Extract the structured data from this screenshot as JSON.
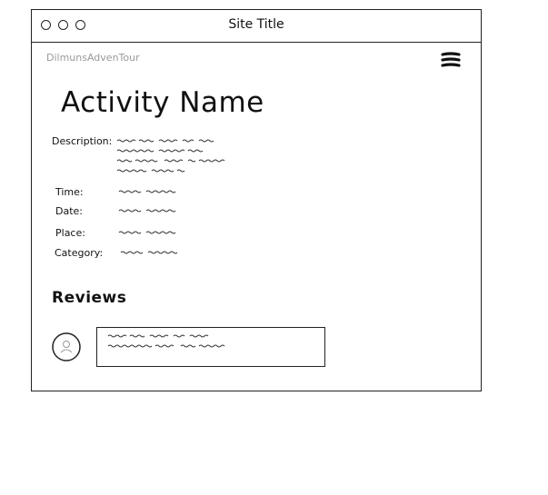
{
  "window": {
    "title": "Site Title"
  },
  "header": {
    "brand": "DilmunsAdvenTour",
    "menu_icon": "hamburger-menu-icon"
  },
  "activity": {
    "title": "Activity Name",
    "fields": {
      "description_label": "Description:",
      "time_label": "Time:",
      "date_label": "Date:",
      "place_label": "Place:",
      "category_label": "Category:"
    }
  },
  "reviews": {
    "title": "Reviews",
    "avatar_icon": "user-avatar-icon"
  }
}
